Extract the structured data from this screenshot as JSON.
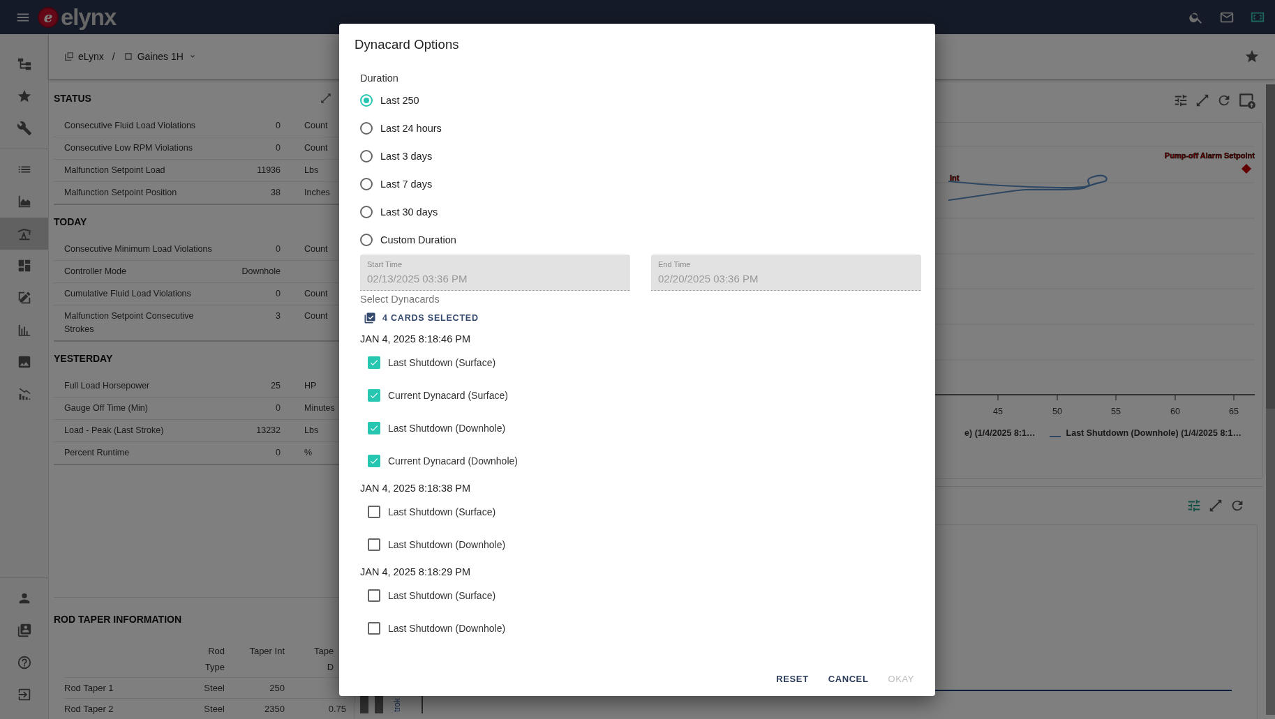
{
  "header": {
    "logo_mark": "e",
    "logo_text": "elynx"
  },
  "sidebar": {
    "top_items": [
      {
        "selected": false
      },
      {
        "selected": false
      },
      {
        "selected": false
      },
      {
        "selected": false
      },
      {
        "selected": false
      },
      {
        "selected": true
      },
      {
        "selected": false
      },
      {
        "selected": false
      },
      {
        "selected": false
      },
      {
        "selected": false
      },
      {
        "selected": false
      }
    ],
    "bottom_items": [
      {
        "selected": false
      },
      {
        "selected": false
      },
      {
        "selected": false
      },
      {
        "selected": false
      }
    ]
  },
  "breadcrumb": {
    "items": [
      {
        "label": "eLynx"
      },
      {
        "label": "Gaines 1H"
      }
    ],
    "separator": "/"
  },
  "status_panel": {
    "sections": [
      {
        "title": "STATUS",
        "rows": [
          {
            "label": "Consecutive Fluid Load Violations",
            "value": "0",
            "unit": "Count"
          },
          {
            "label": "Consecutive Low RPM Violations",
            "value": "0",
            "unit": "Count"
          },
          {
            "label": "Malfunction Setpoint Load",
            "value": "11936",
            "unit": "Lbs"
          },
          {
            "label": "Malfunction Setpoint Position",
            "value": "38",
            "unit": "Inches"
          }
        ]
      },
      {
        "title": "TODAY",
        "rows": [
          {
            "label": "Consecutive Minimum Load Violations",
            "value": "0",
            "unit": "Count"
          },
          {
            "label": "Controller Mode",
            "value": "Downhole"
          },
          {
            "label": "Cumulative Fluid Load Violations",
            "value": "0",
            "unit": "Count"
          },
          {
            "label": "Malfunction Setpoint Consecutive Strokes",
            "value": "3",
            "unit": "Count"
          }
        ]
      },
      {
        "title": "YESTERDAY",
        "rows": [
          {
            "label": "Full Load Horsepower",
            "value": "25",
            "unit": "HP"
          },
          {
            "label": "Gauge Off Time (Min)",
            "value": "0",
            "unit": "Minutes"
          },
          {
            "label": "Load - Peak (Last Stroke)",
            "value": "13232",
            "unit": "Lbs"
          },
          {
            "label": "Percent Runtime",
            "value": "0",
            "unit": "%"
          }
        ]
      }
    ]
  },
  "rod_taper": {
    "title": "ROD TAPER INFORMATION",
    "columns": [
      "Rod Type",
      "Taper Int",
      "Tape D"
    ],
    "rows": [
      {
        "name": "Rod Taper 1",
        "cells": [
          "Steel",
          "250"
        ]
      },
      {
        "name": "Rod Taper 2",
        "cells": [
          "Steel",
          "2350",
          "0.75"
        ]
      }
    ]
  },
  "chart_panels": [
    {
      "filter_active": false,
      "annotations": [
        "int",
        "Pump-off Alarm Setpoint"
      ],
      "x_ticks": [
        "45",
        "50",
        "55",
        "60",
        "65"
      ],
      "legend": [
        "e) (1/4/2025 8:1…",
        "Last Shutdown (Downhole) (1/4/2025 8:1…"
      ]
    },
    {
      "filter_active": true,
      "axis_title": "trok"
    }
  ],
  "dialog": {
    "title": "Dynacard Options",
    "duration_label": "Duration",
    "durations": [
      {
        "label": "Last 250",
        "selected": true
      },
      {
        "label": "Last 24 hours",
        "selected": false
      },
      {
        "label": "Last 3 days",
        "selected": false
      },
      {
        "label": "Last 7 days",
        "selected": false
      },
      {
        "label": "Last 30 days",
        "selected": false
      },
      {
        "label": "Custom Duration",
        "selected": false
      }
    ],
    "time_fields": [
      {
        "label": "Start Time",
        "value": "02/13/2025 03:36 PM",
        "disabled": true
      },
      {
        "label": "End Time",
        "value": "02/20/2025 03:36 PM",
        "disabled": true
      }
    ],
    "select_label": "Select Dynacards",
    "selection_summary": "4 CARDS SELECTED",
    "groups": [
      {
        "timestamp": "JAN 4, 2025 8:18:46 PM",
        "cards": [
          {
            "label": "Last Shutdown (Surface)",
            "checked": true
          },
          {
            "label": "Current Dynacard (Surface)",
            "checked": true
          },
          {
            "label": "Last Shutdown (Downhole)",
            "checked": true
          },
          {
            "label": "Current Dynacard (Downhole)",
            "checked": true
          }
        ]
      },
      {
        "timestamp": "JAN 4, 2025 8:18:38 PM",
        "cards": [
          {
            "label": "Last Shutdown (Surface)",
            "checked": false
          },
          {
            "label": "Last Shutdown (Downhole)",
            "checked": false
          }
        ]
      },
      {
        "timestamp": "JAN 4, 2025 8:18:29 PM",
        "cards": [
          {
            "label": "Last Shutdown (Surface)",
            "checked": false
          },
          {
            "label": "Last Shutdown (Downhole)",
            "checked": false
          }
        ]
      }
    ],
    "buttons": [
      {
        "label": "RESET",
        "disabled": false
      },
      {
        "label": "CANCEL",
        "disabled": false
      },
      {
        "label": "OKAY",
        "disabled": true
      }
    ]
  }
}
